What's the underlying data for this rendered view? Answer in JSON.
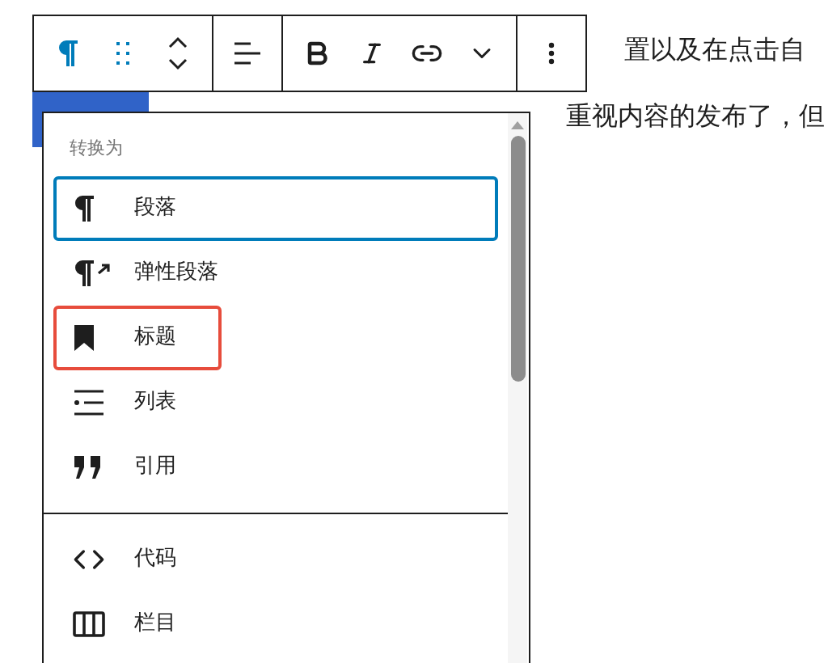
{
  "content": {
    "lines": [
      "置以及在点击自",
      "重视内容的发布了，但"
    ],
    "selection": true
  },
  "toolbar": {
    "groups": [
      {
        "buttons": [
          {
            "kind": "paragraph",
            "selected": true
          },
          {
            "kind": "drag"
          },
          {
            "kind": "move"
          }
        ]
      },
      {
        "buttons": [
          {
            "kind": "align"
          }
        ]
      },
      {
        "buttons": [
          {
            "kind": "bold"
          },
          {
            "kind": "italic"
          },
          {
            "kind": "link"
          },
          {
            "kind": "more"
          }
        ]
      },
      {
        "buttons": [
          {
            "kind": "options"
          }
        ]
      }
    ]
  },
  "menu": {
    "heading": "转换为",
    "sections": [
      {
        "items": [
          {
            "kind": "paragraph",
            "label": "段落",
            "selected": true,
            "highlighted": false
          },
          {
            "kind": "flex",
            "label": "弹性段落",
            "selected": false,
            "highlighted": false
          },
          {
            "kind": "heading",
            "label": "标题",
            "selected": false,
            "highlighted": true
          },
          {
            "kind": "list",
            "label": "列表",
            "selected": false,
            "highlighted": false
          },
          {
            "kind": "quote",
            "label": "引用",
            "selected": false,
            "highlighted": false
          }
        ]
      },
      {
        "items": [
          {
            "kind": "code",
            "label": "代码",
            "selected": false,
            "highlighted": false
          },
          {
            "kind": "columns",
            "label": "栏目",
            "selected": false,
            "highlighted": false
          }
        ]
      }
    ]
  }
}
